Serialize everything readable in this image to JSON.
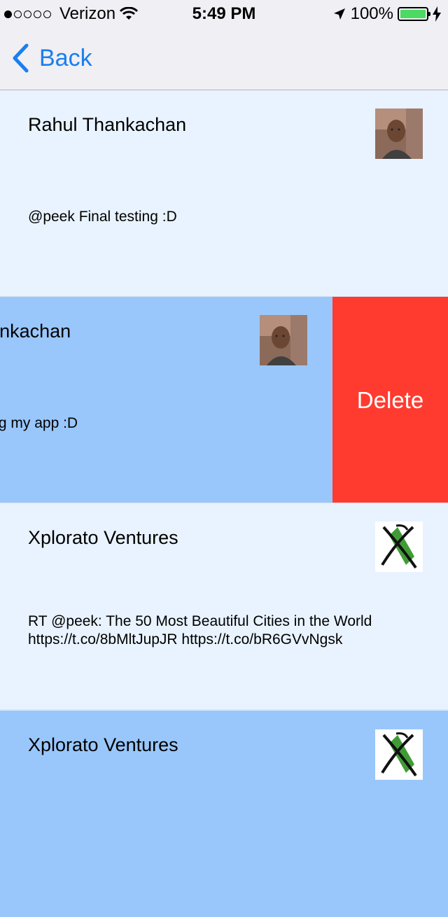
{
  "status_bar": {
    "carrier": "Verizon",
    "time": "5:49 PM",
    "battery": "100%"
  },
  "nav": {
    "back_label": "Back"
  },
  "rows": [
    {
      "name": "Rahul Thankachan",
      "text": "@peek Final testing :D",
      "avatar": "profile-photo"
    },
    {
      "name": "Rahul Thankachan",
      "text": "@peek testing my app :D",
      "avatar": "profile-photo",
      "delete_label": "Delete",
      "swiped": true
    },
    {
      "name": "Xplorato Ventures",
      "text": "RT @peek: The 50 Most Beautiful Cities in the World\nhttps://t.co/8bMltJupJR https://t.co/bR6GVvNgsk",
      "avatar": "xplorato-logo"
    },
    {
      "name": "Xplorato Ventures",
      "text": "",
      "avatar": "xplorato-logo"
    }
  ],
  "colors": {
    "row_light": "#e8f3ff",
    "row_selected": "#99c7fb",
    "delete": "#ff3b30",
    "accent": "#1a7ef0"
  }
}
